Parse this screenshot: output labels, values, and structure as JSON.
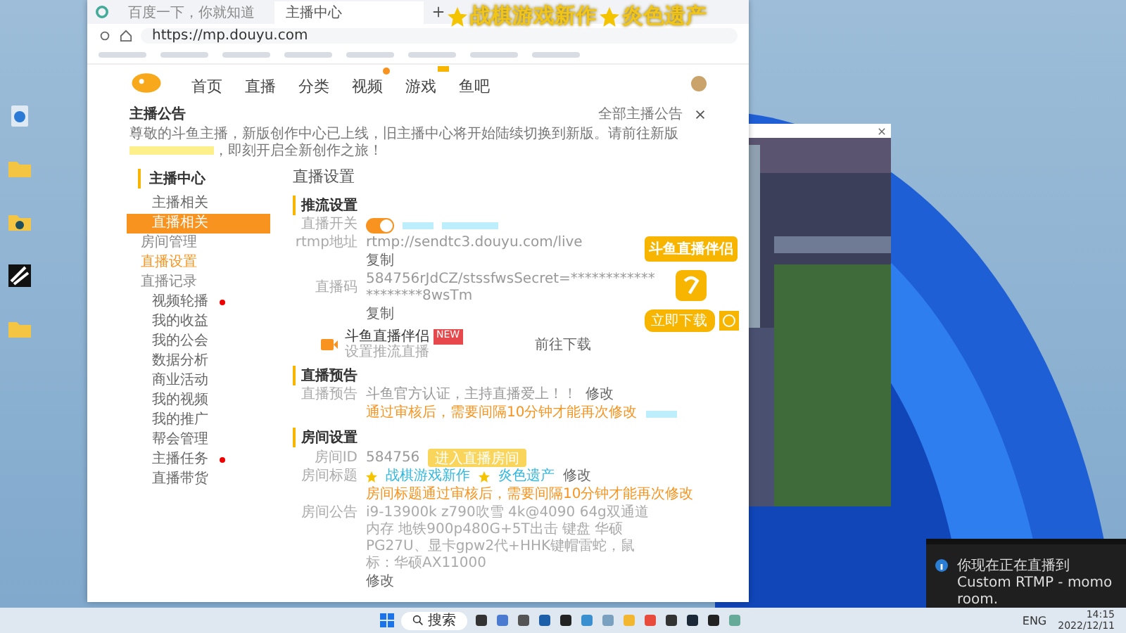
{
  "browser": {
    "tabs": [
      {
        "title": "百度一下，你就知道",
        "selected": false
      },
      {
        "title": "主播中心",
        "selected": true
      }
    ],
    "address": "https://mp.douyu.com"
  },
  "overlay": {
    "parts": [
      "战棋游戏新作",
      "炎色遗产"
    ]
  },
  "site": {
    "nav": [
      {
        "label": "首页",
        "dot": false,
        "tag": false
      },
      {
        "label": "直播",
        "dot": false,
        "tag": false
      },
      {
        "label": "分类",
        "dot": false,
        "tag": false
      },
      {
        "label": "视频",
        "dot": true,
        "tag": false
      },
      {
        "label": "游戏",
        "dot": false,
        "tag": true
      },
      {
        "label": "鱼吧",
        "dot": false,
        "tag": false
      }
    ]
  },
  "notice": {
    "title": "主播公告",
    "more": "全部主播公告",
    "before": "尊敬的斗鱼主播，新版创作中心已上线，旧主播中心将开始陆续切换到新版。请前往新版",
    "after": "，即刻开启全新创作之旅！"
  },
  "sidebar": {
    "title": "主播中心",
    "items": [
      {
        "label": "主播相关",
        "expanded": false,
        "dot": false
      },
      {
        "label": "直播相关",
        "expanded": true,
        "dot": false,
        "children": [
          {
            "label": "房间管理",
            "selected": false
          },
          {
            "label": "直播设置",
            "selected": true
          },
          {
            "label": "直播记录",
            "selected": false
          }
        ]
      },
      {
        "label": "视频轮播",
        "expanded": false,
        "dot": true
      },
      {
        "label": "我的收益",
        "expanded": false,
        "dot": false
      },
      {
        "label": "我的公会",
        "expanded": false,
        "dot": false
      },
      {
        "label": "数据分析",
        "expanded": false,
        "dot": false
      },
      {
        "label": "商业活动",
        "expanded": false,
        "dot": false
      },
      {
        "label": "我的视频",
        "expanded": false,
        "dot": false
      },
      {
        "label": "我的推广",
        "expanded": false,
        "dot": false
      },
      {
        "label": "帮会管理",
        "expanded": false,
        "dot": false
      },
      {
        "label": "主播任务",
        "expanded": false,
        "dot": true
      },
      {
        "label": "直播带货",
        "expanded": false,
        "dot": false
      }
    ]
  },
  "settings": {
    "title": "直播设置",
    "push": {
      "heading": "推流设置",
      "toggle_label": "直播开关",
      "on": true,
      "rtmp_label": "rtmp地址",
      "rtmp": "rtmp://sendtc3.douyu.com/live",
      "copy": "复制",
      "code_label": "直播码",
      "code": "584756rJdCZ/stssfwsSecret=********************8wsTm",
      "copy2": "复制",
      "companion": {
        "name": "斗鱼直播伴侣",
        "badge": "NEW",
        "sub": "设置推流直播",
        "download": "前往下载"
      }
    },
    "preview": {
      "heading": "直播预告",
      "label": "直播预告",
      "text": "斗鱼官方认证，主持直播爱上！！",
      "edit": "修改",
      "warning": "通过审核后，需要间隔10分钟才能再次修改"
    },
    "room": {
      "heading": "房间设置",
      "id_label": "房间ID",
      "id": "584756",
      "enter": "进入直播房间",
      "title_label": "房间标题",
      "title_parts": [
        "战棋游戏新作",
        "炎色遗产"
      ],
      "edit": "修改",
      "warning": "房间标题通过审核后，需要间隔10分钟才能再次修改",
      "notice_label": "房间公告",
      "notice": "i9-13900k z790吹雪 4k@4090 64g双通道内存 地铁900p480G+5T出击 键盘 华硕PG27U、显卡gpw2代+HHK键帽雷蛇，鼠标：华硕AX11000",
      "edit2": "修改"
    }
  },
  "promo": {
    "title": "斗鱼直播伴侣",
    "download": "立即下载"
  },
  "notification": {
    "text": "你现在正在直播到 Custom RTMP - momo room."
  },
  "taskbar": {
    "search": "搜索",
    "lang": "ENG",
    "time": "14:15",
    "date": "2022/12/11"
  }
}
